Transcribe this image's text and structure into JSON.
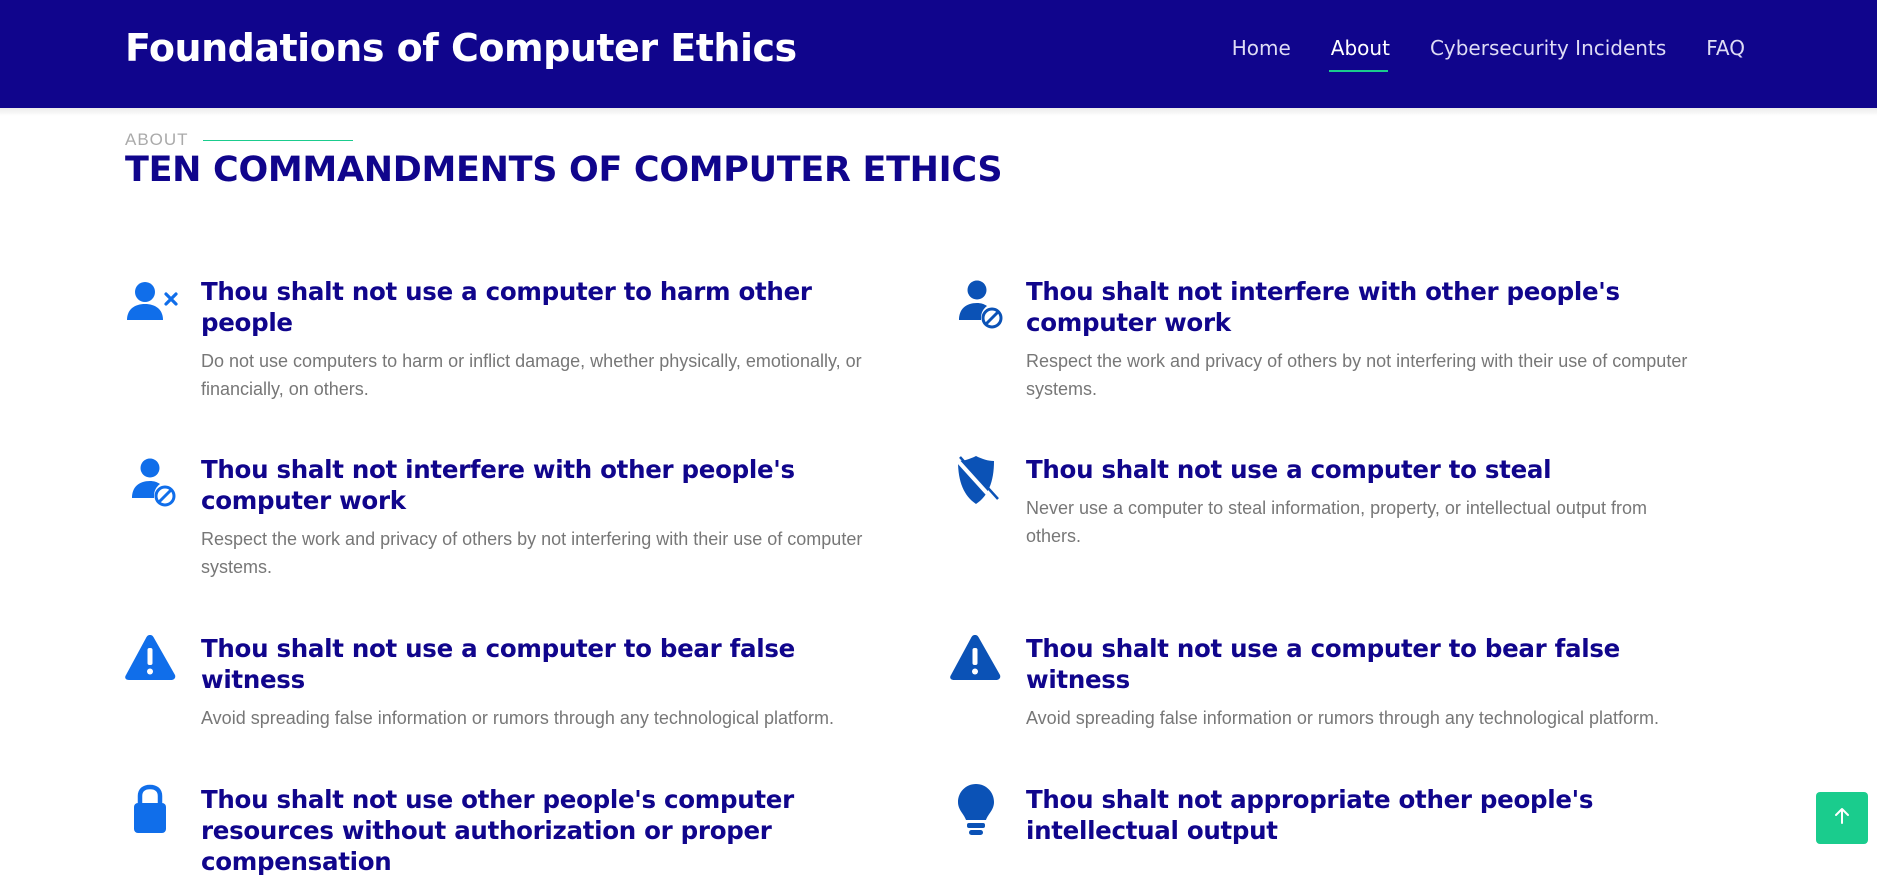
{
  "header": {
    "brand": "Foundations of Computer Ethics",
    "nav": [
      {
        "label": "Home",
        "active": false
      },
      {
        "label": "About",
        "active": true
      },
      {
        "label": "Cybersecurity Incidents",
        "active": false
      },
      {
        "label": "FAQ",
        "active": false
      }
    ]
  },
  "section": {
    "kicker": "ABOUT",
    "title": "TEN COMMANDMENTS OF COMPUTER ETHICS"
  },
  "items": [
    {
      "icon": "user-x-icon",
      "title": "Thou shalt not use a computer to harm other people",
      "description": "Do not use computers to harm or inflict damage, whether physically, emotionally, or financially, on others."
    },
    {
      "icon": "user-slash-icon",
      "title": "Thou shalt not interfere with other people's computer work",
      "description": "Respect the work and privacy of others by not interfering with their use of computer systems."
    },
    {
      "icon": "user-slash-icon",
      "title": "Thou shalt not interfere with other people's computer work",
      "description": "Respect the work and privacy of others by not interfering with their use of computer systems."
    },
    {
      "icon": "shield-slash-icon",
      "title": "Thou shalt not use a computer to steal",
      "description": "Never use a computer to steal information, property, or intellectual output from others."
    },
    {
      "icon": "warning-icon",
      "title": "Thou shalt not use a computer to bear false witness",
      "description": "Avoid spreading false information or rumors through any technological platform."
    },
    {
      "icon": "warning-icon",
      "title": "Thou shalt not use a computer to bear false witness",
      "description": "Avoid spreading false information or rumors through any technological platform."
    },
    {
      "icon": "lock-icon",
      "title": "Thou shalt not use other people's computer resources without authorization or proper compensation",
      "description": ""
    },
    {
      "icon": "lightbulb-icon",
      "title": "Thou shalt not appropriate other people's intellectual output",
      "description": ""
    }
  ],
  "colors": {
    "header_bg": "#10058c",
    "accent": "#1acc8d",
    "heading": "#10058c",
    "icon_blue_light": "#106eea",
    "icon_blue_dark": "#0b52b6",
    "body_text": "#777777"
  },
  "back_to_top": {
    "icon": "arrow-up-icon"
  }
}
